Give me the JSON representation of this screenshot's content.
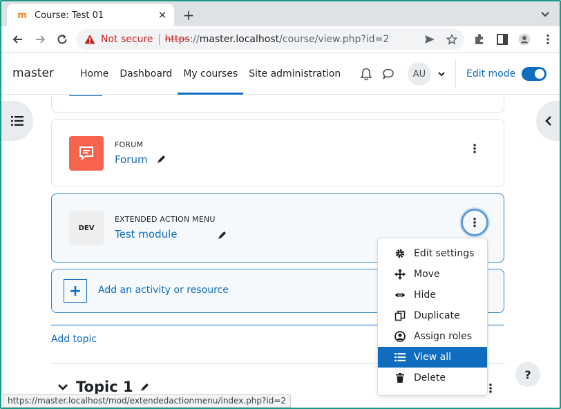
{
  "browser": {
    "tab_title": "Course: Test 01",
    "favicon_letter": "m",
    "close_glyph": "✕",
    "new_tab_glyph": "+",
    "not_secure": "Not secure",
    "url_scheme": "https",
    "url_sep": "://",
    "url_host": "master.localhost",
    "url_path": "/course/view.php?id=2",
    "status_url": "https://master.localhost/mod/extendedactionmenu/index.php?id=2"
  },
  "navbar": {
    "brand": "master",
    "links": [
      "Home",
      "Dashboard",
      "My courses",
      "Site administration"
    ],
    "active_link": "My courses",
    "avatar_initials": "AU",
    "edit_mode_label": "Edit mode",
    "edit_mode_on": true
  },
  "activities": [
    {
      "type_label": "FORUM",
      "name": "Forum",
      "icon": "forum-icon",
      "icon_color": "#f7634d"
    },
    {
      "type_label": "EXTENDED ACTION MENU",
      "name": "Test module",
      "icon_text": "DEV",
      "icon_color": "#eeeeee"
    }
  ],
  "add_activity": {
    "plus": "+",
    "label": "Add an activity or resource"
  },
  "add_topic": "Add topic",
  "topic": {
    "title": "Topic 1"
  },
  "action_menu": {
    "items": [
      {
        "label": "Edit settings",
        "icon": "gear-icon"
      },
      {
        "label": "Move",
        "icon": "move-arrows-icon"
      },
      {
        "label": "Hide",
        "icon": "eye-icon"
      },
      {
        "label": "Duplicate",
        "icon": "copy-icon"
      },
      {
        "label": "Assign roles",
        "icon": "user-circle-icon"
      },
      {
        "label": "View all",
        "icon": "list-icon",
        "active": true
      },
      {
        "label": "Delete",
        "icon": "trash-icon"
      }
    ]
  },
  "help": "?",
  "colors": {
    "primary": "#0f6cbf",
    "danger": "#c5221f",
    "forum": "#f7634d"
  }
}
